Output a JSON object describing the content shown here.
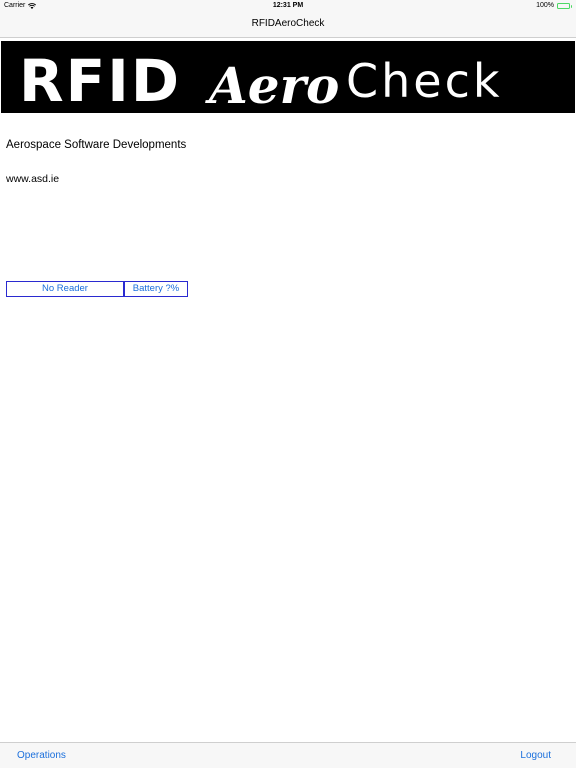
{
  "status_bar": {
    "carrier": "Carrier",
    "time": "12:31 PM",
    "battery_percent": "100%",
    "icons": [
      "wifi-icon",
      "battery-icon"
    ],
    "battery_color": "#4cd964"
  },
  "nav": {
    "title": "RFIDAeroCheck"
  },
  "banner": {
    "logo_text_plain": "RFID",
    "logo_text_script": "Aero",
    "logo_text_end": "Check",
    "background": "#000000",
    "text_color": "#ffffff"
  },
  "main": {
    "company": "Aerospace Software Developments",
    "website": "www.asd.ie",
    "reader_button": "No Reader",
    "battery_button": "Battery ?%"
  },
  "toolbar": {
    "left_label": "Operations",
    "right_label": "Logout",
    "accent": "#1a6fdc"
  }
}
